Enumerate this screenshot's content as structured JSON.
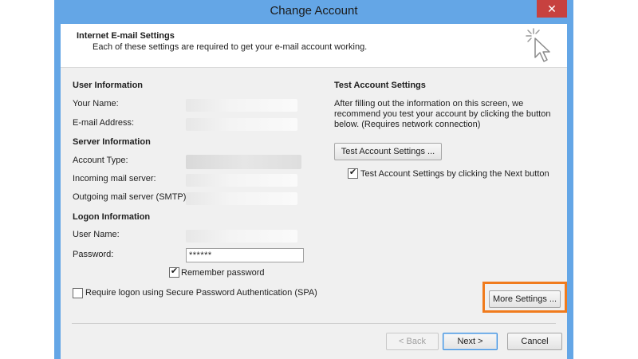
{
  "window": {
    "title": "Change Account",
    "close_label": "✕"
  },
  "header": {
    "title": "Internet E-mail Settings",
    "subtitle": "Each of these settings are required to get your e-mail account working."
  },
  "user_info": {
    "section_title": "User Information",
    "name_label": "Your Name:",
    "email_label": "E-mail Address:"
  },
  "server_info": {
    "section_title": "Server Information",
    "account_type_label": "Account Type:",
    "incoming_label": "Incoming mail server:",
    "outgoing_label": "Outgoing mail server (SMTP):"
  },
  "logon_info": {
    "section_title": "Logon Information",
    "username_label": "User Name:",
    "password_label": "Password:",
    "password_value": "******",
    "remember_label": "Remember password",
    "remember_checked": true,
    "spa_label": "Require logon using Secure Password Authentication (SPA)",
    "spa_checked": false
  },
  "test_settings": {
    "section_title": "Test Account Settings",
    "description_line1": "After filling out the information on this screen, we",
    "description_line2": "recommend you test your account by clicking the button",
    "description_line3": "below. (Requires network connection)",
    "test_button": "Test Account Settings ...",
    "next_test_label": "Test Account Settings by clicking the Next button",
    "next_test_checked": true
  },
  "more_settings_button": "More Settings ...",
  "footer": {
    "back_button": "< Back",
    "next_button": "Next >",
    "cancel_button": "Cancel"
  },
  "colors": {
    "title_bar": "#64a6e6",
    "close_button": "#c7413f",
    "highlight": "#f07b1d"
  }
}
